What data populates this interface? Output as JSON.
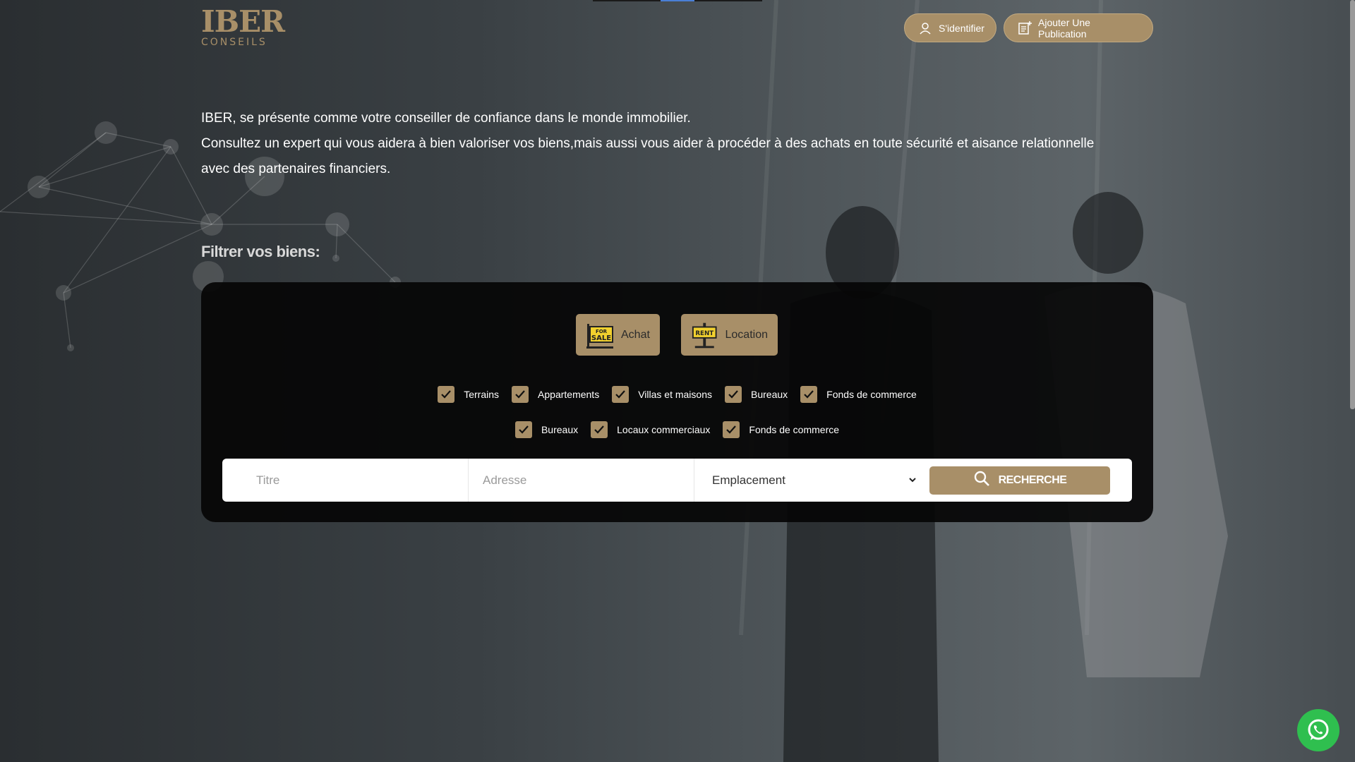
{
  "brand": {
    "logo_main": "IBER",
    "logo_sub": "CONSEILS"
  },
  "header": {
    "login_label": "S'identifier",
    "publish_label": "Ajouter Une Publication"
  },
  "intro": {
    "line1": "IBER, se présente comme votre conseiller de confiance dans le monde immobilier.",
    "line2": "Consultez un expert qui vous aidera à bien valoriser vos biens,mais aussi vous aider à procéder à des achats en toute sécurité et aisance relationnelle avec des partenaires financiers."
  },
  "filter": {
    "title": "Filtrer vos biens:",
    "tabs": [
      {
        "label": "Achat",
        "icon": "for-sale-sign-icon",
        "sign_text_1": "FOR",
        "sign_text_2": "SALE"
      },
      {
        "label": "Location",
        "icon": "rent-sign-icon",
        "sign_text": "RENT"
      }
    ],
    "row1": [
      {
        "label": "Terrains",
        "checked": true
      },
      {
        "label": "Appartements",
        "checked": true
      },
      {
        "label": "Villas et maisons",
        "checked": true
      },
      {
        "label": "Bureaux",
        "checked": true
      },
      {
        "label": "Fonds de commerce",
        "checked": true
      }
    ],
    "row2": [
      {
        "label": "Bureaux",
        "checked": true
      },
      {
        "label": "Locaux commerciaux",
        "checked": true
      },
      {
        "label": "Fonds de commerce",
        "checked": true
      }
    ],
    "search": {
      "title_placeholder": "Titre",
      "address_placeholder": "Adresse",
      "location_value": "Emplacement",
      "button_label": "RECHERCHE"
    }
  },
  "colors": {
    "accent": "#a88f68",
    "panel": "#050505",
    "whatsapp": "#2fbf4f"
  }
}
